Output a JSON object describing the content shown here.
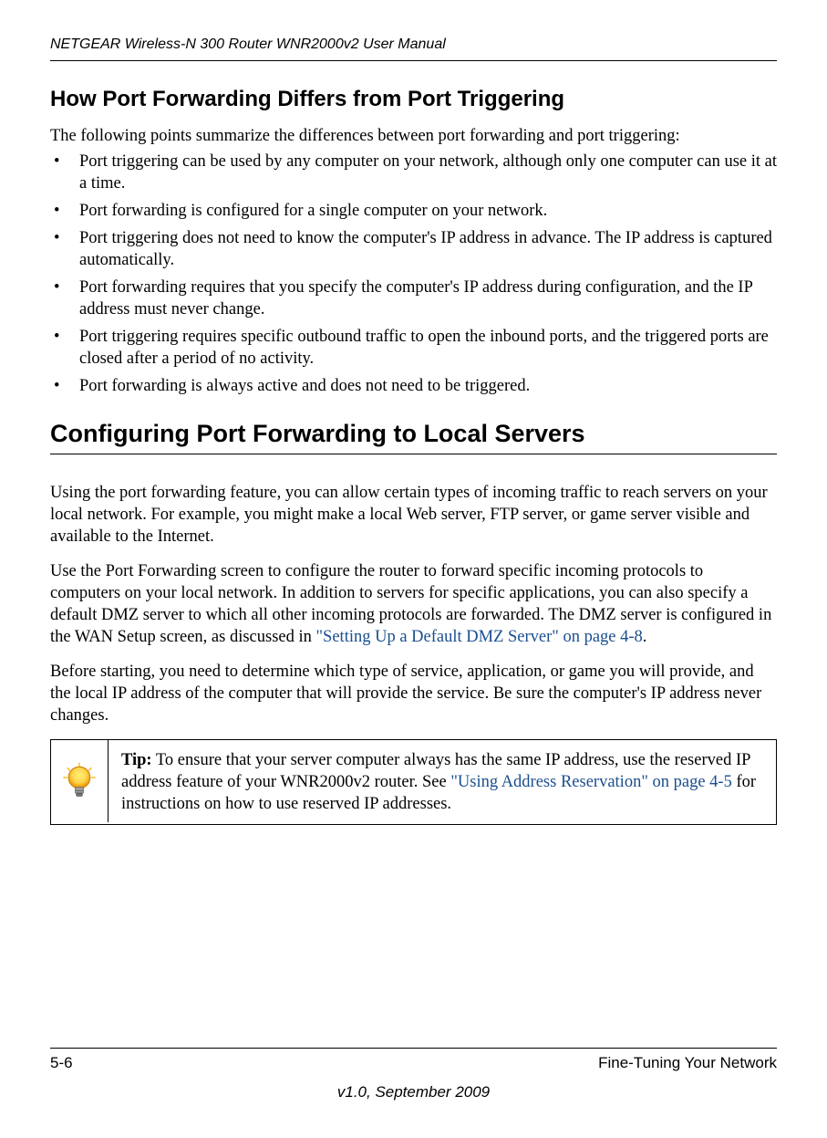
{
  "header": {
    "manual_title": "NETGEAR Wireless-N 300 Router WNR2000v2 User Manual"
  },
  "sections": {
    "heading1": "How Port Forwarding Differs from Port Triggering",
    "intro1": "The following points summarize the differences between port forwarding and port triggering:",
    "bullets": [
      "Port triggering can be used by any computer on your network, although only one computer can use it at a time.",
      "Port forwarding is configured for a single computer on your network.",
      "Port triggering does not need to know the computer's IP address in advance. The IP address is captured automatically.",
      "Port forwarding requires that you specify the computer's IP address during configuration, and the IP address must never change.",
      "Port triggering requires specific outbound traffic to open the inbound ports, and the triggered ports are closed after a period of no activity.",
      "Port forwarding is always active and does not need to be triggered."
    ],
    "heading2": "Configuring Port Forwarding to Local Servers",
    "para1": "Using the port forwarding feature, you can allow certain types of incoming traffic to reach servers on your local network. For example, you might make a local Web server, FTP server, or game server visible and available to the Internet.",
    "para2_part1": "Use the Port Forwarding screen to configure the router to forward specific incoming protocols to computers on your local network. In addition to servers for specific applications, you can also specify a default DMZ server to which all other incoming protocols are forwarded. The DMZ server is configured in the WAN Setup screen, as discussed in ",
    "para2_link": "\"Setting Up a Default DMZ Server\" on page 4-8",
    "para2_part2": ".",
    "para3": "Before starting, you need to determine which type of service, application, or game you will provide, and the local IP address of the computer that will provide the service. Be sure the computer's IP address never changes.",
    "tip": {
      "label": "Tip:",
      "text_part1": " To ensure that your server computer always has the same IP address, use the reserved IP address feature of your WNR2000v2 router. See ",
      "link": "\"Using Address Reservation\" on page 4-5",
      "text_part2": " for instructions on how to use reserved IP addresses."
    }
  },
  "footer": {
    "page_number": "5-6",
    "chapter_title": "Fine-Tuning Your Network",
    "version": "v1.0, September 2009"
  }
}
